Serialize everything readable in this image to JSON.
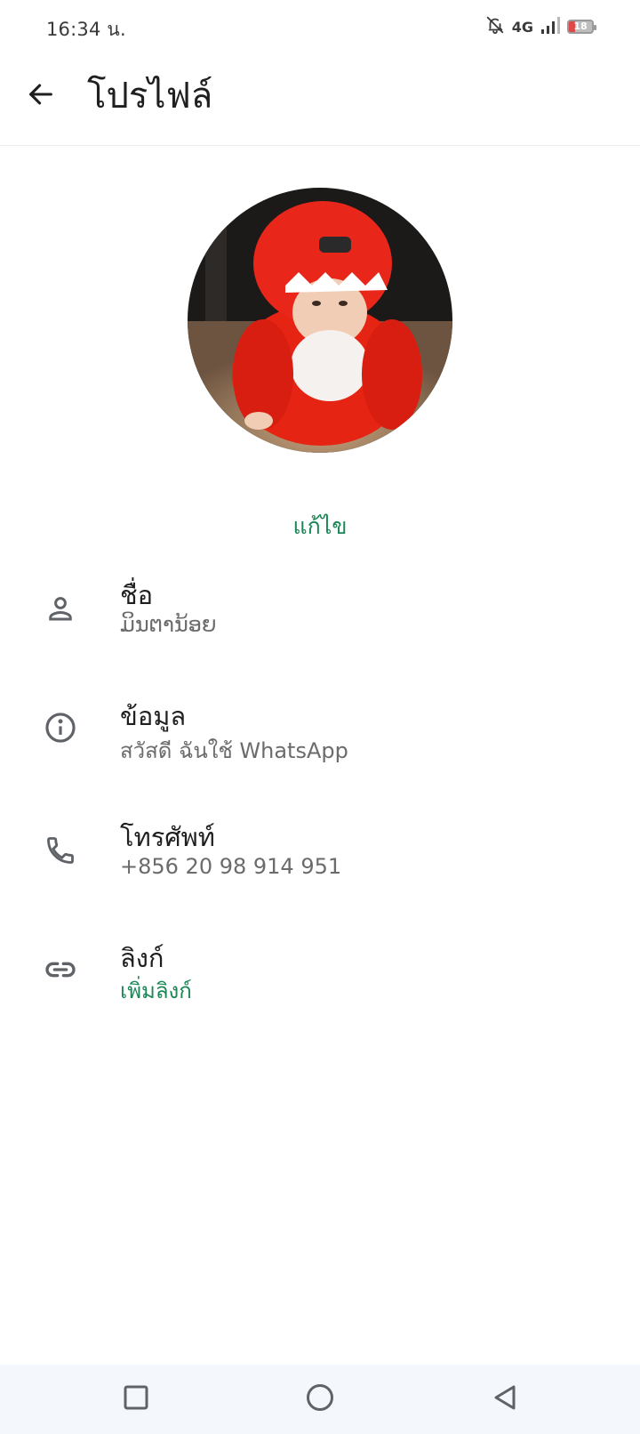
{
  "status_bar": {
    "time": "16:34 น.",
    "network": "4G",
    "battery_level": "18",
    "icons": [
      "bell-muted-icon",
      "signal-icon",
      "battery-icon"
    ]
  },
  "app_bar": {
    "title": "โปรไฟล์",
    "back_icon": "arrow-left-icon"
  },
  "profile": {
    "edit_label": "แก้ไข"
  },
  "rows": [
    {
      "icon": "person-icon",
      "title": "ชื่อ",
      "value": "ມິນຕານ້ອຍ"
    },
    {
      "icon": "info-icon",
      "title": "ข้อมูล",
      "value": "สวัสดี ฉันใช้ WhatsApp"
    },
    {
      "icon": "phone-icon",
      "title": "โทรศัพท์",
      "value": "+856 20 98 914 951"
    },
    {
      "icon": "link-icon",
      "title": "ลิงก์",
      "value": "เพิ่มลิงก์"
    }
  ],
  "colors": {
    "accent": "#1b8755",
    "text_primary": "#1f1f1f",
    "text_secondary": "#6b6b6b",
    "icon": "#5f6368",
    "nav_bg": "#f4f7fb"
  },
  "nav_bar": {
    "icons": [
      "recents-square-icon",
      "home-circle-icon",
      "back-triangle-icon"
    ]
  }
}
